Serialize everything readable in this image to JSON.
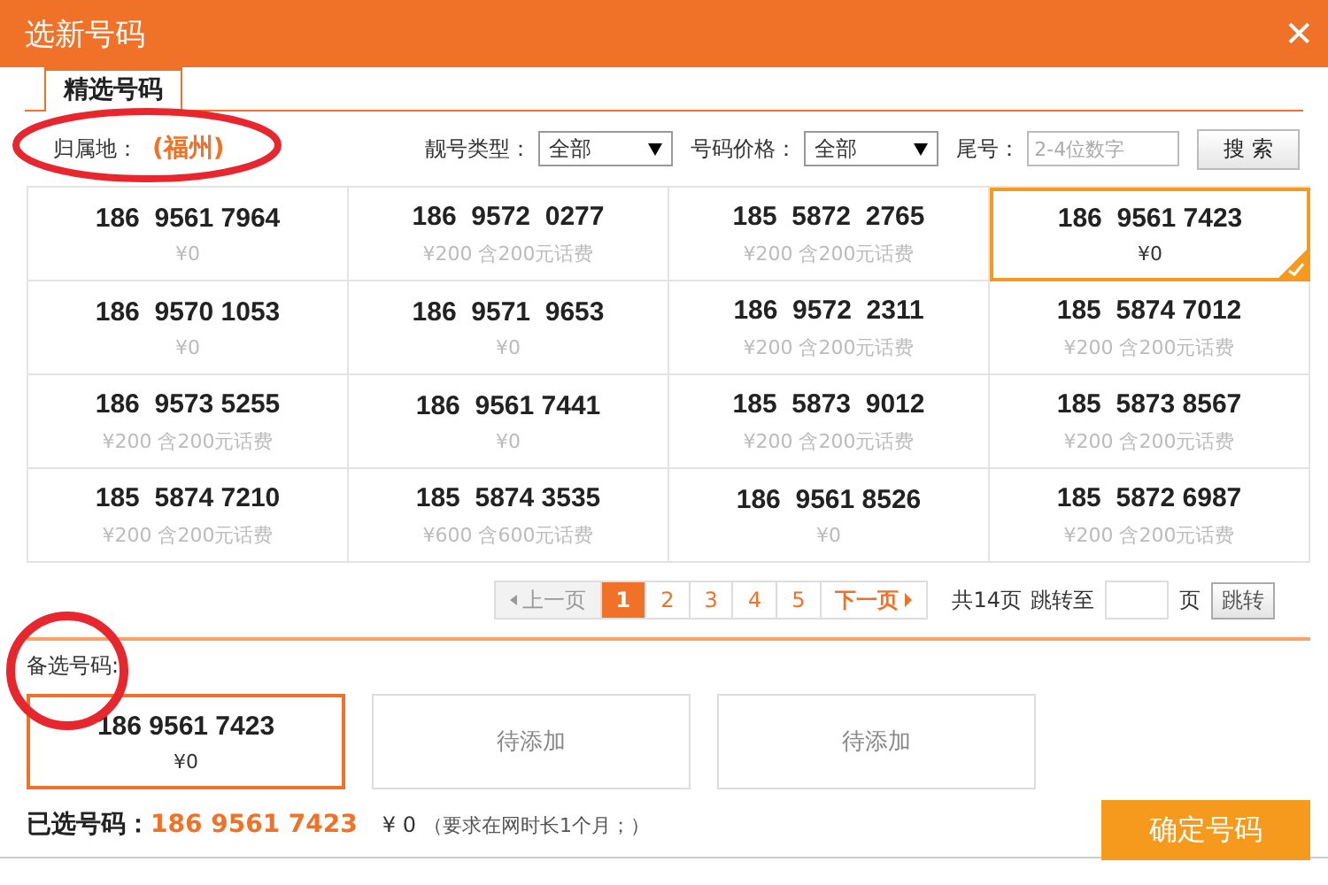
{
  "window": {
    "title": "选新号码",
    "close": "✕"
  },
  "tabs": [
    {
      "label": "精选号码",
      "selected": true
    }
  ],
  "filters": {
    "location_label": "归属地：",
    "location": "(福州)",
    "type_label": "靓号类型：",
    "type_value": "全部",
    "price_label": "号码价格：",
    "price_value": "全部",
    "tail_label": "尾号：",
    "tail_placeholder": "2-4位数字",
    "search_button": "搜 索"
  },
  "numbers": [
    {
      "number": "186  9561 7964",
      "price": "¥0",
      "selected": false
    },
    {
      "number": "186  9572  0277",
      "price": "¥200 含200元话费",
      "selected": false
    },
    {
      "number": "185  5872  2765",
      "price": "¥200 含200元话费",
      "selected": false
    },
    {
      "number": "186  9561 7423",
      "price": "¥0",
      "selected": true
    },
    {
      "number": "186  9570 1053",
      "price": "¥0",
      "selected": false
    },
    {
      "number": "186  9571  9653",
      "price": "¥0",
      "selected": false
    },
    {
      "number": "186  9572  2311",
      "price": "¥200 含200元话费",
      "selected": false
    },
    {
      "number": "185  5874 7012",
      "price": "¥200 含200元话费",
      "selected": false
    },
    {
      "number": "186  9573 5255",
      "price": "¥200 含200元话费",
      "selected": false
    },
    {
      "number": "186  9561 7441",
      "price": "¥0",
      "selected": false
    },
    {
      "number": "185  5873  9012",
      "price": "¥200 含200元话费",
      "selected": false
    },
    {
      "number": "185  5873 8567",
      "price": "¥200 含200元话费",
      "selected": false
    },
    {
      "number": "185  5874 7210",
      "price": "¥200 含200元话费",
      "selected": false
    },
    {
      "number": "185  5874 3535",
      "price": "¥600 含600元话费",
      "selected": false
    },
    {
      "number": "186  9561 8526",
      "price": "¥0",
      "selected": false
    },
    {
      "number": "185  5872 6987",
      "price": "¥200 含200元话费",
      "selected": false
    }
  ],
  "pagination": {
    "prev": {
      "label": "上一页",
      "disabled": true
    },
    "pages": [
      {
        "label": "1",
        "selected": true
      },
      {
        "label": "2",
        "selected": false
      },
      {
        "label": "3",
        "selected": false
      },
      {
        "label": "4",
        "selected": false
      },
      {
        "label": "5",
        "selected": false
      }
    ],
    "next": {
      "label": "下一页",
      "disabled": false
    },
    "total": "共14页",
    "jump_label": "跳转至",
    "page_unit": "页",
    "jump_button": "跳转"
  },
  "backup": {
    "label": "备选号码:",
    "slots": [
      {
        "kind": "number",
        "number": "186 9561 7423",
        "price": "¥0"
      },
      {
        "kind": "empty",
        "text": "待添加"
      },
      {
        "kind": "empty",
        "text": "待添加"
      }
    ]
  },
  "summary": {
    "label": "已选号码：",
    "number": "186 9561 7423",
    "price": "¥ 0",
    "note": "（要求在网时长1个月；）"
  },
  "confirm_button": "确定号码"
}
